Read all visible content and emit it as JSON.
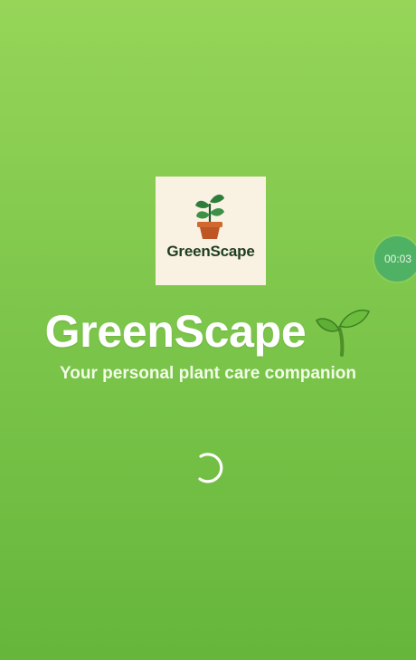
{
  "app": {
    "name": "GreenScape",
    "tagline": "Your personal plant care companion"
  },
  "logo": {
    "wordmark": "GreenScape",
    "icon": "potted-plant-icon"
  },
  "title_icon": "sprout-icon",
  "loading": {
    "icon": "loading-spinner-icon"
  },
  "recording_timer": {
    "time": "00:03"
  },
  "colors": {
    "background_top": "#96d558",
    "background_bottom": "#66b63c",
    "logo_card": "#f9f2e3",
    "logo_text": "#1f3d22",
    "timer_badge": "#4eb163"
  }
}
